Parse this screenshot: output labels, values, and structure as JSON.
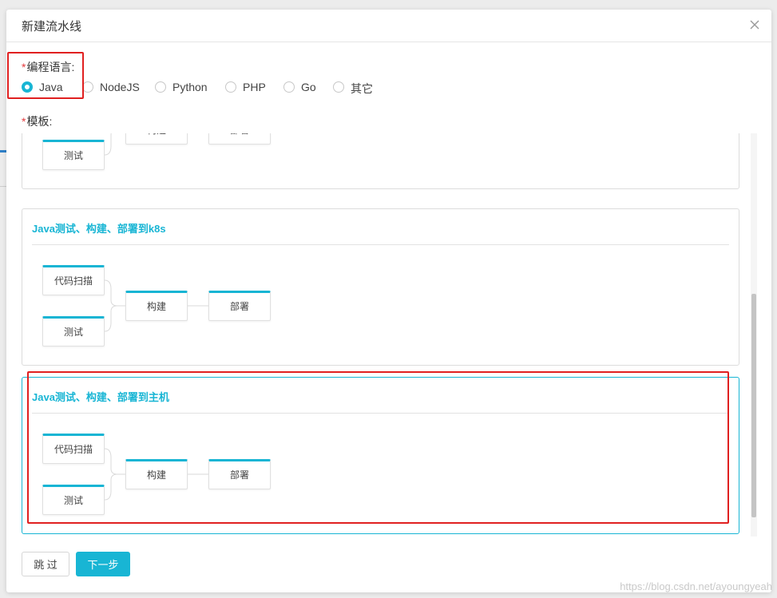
{
  "modal": {
    "title": "新建流水线",
    "close_glyph": "×"
  },
  "form": {
    "language_label": "编程语言:",
    "template_label": "模板:",
    "required_mark": "*"
  },
  "languages": [
    {
      "label": "Java",
      "checked": true
    },
    {
      "label": "NodeJS",
      "checked": false
    },
    {
      "label": "Python",
      "checked": false
    },
    {
      "label": "PHP",
      "checked": false
    },
    {
      "label": "Go",
      "checked": false
    },
    {
      "label": "其它",
      "checked": false
    }
  ],
  "templates": [
    {
      "title": "",
      "stages": {
        "scan": "",
        "test": "测试",
        "build": "构建",
        "deploy": "部署"
      }
    },
    {
      "title": "Java测试、构建、部署到k8s",
      "stages": {
        "scan": "代码扫描",
        "test": "测试",
        "build": "构建",
        "deploy": "部署"
      }
    },
    {
      "title": "Java测试、构建、部署到主机",
      "stages": {
        "scan": "代码扫描",
        "test": "测试",
        "build": "构建",
        "deploy": "部署"
      }
    }
  ],
  "footer": {
    "skip_label": "跳 过",
    "next_label": "下一步"
  },
  "watermark": "https://blog.csdn.net/ayoungyeah",
  "colors": {
    "accent": "#18b5d4",
    "required": "#e4393c",
    "annotation": "#e02020"
  }
}
